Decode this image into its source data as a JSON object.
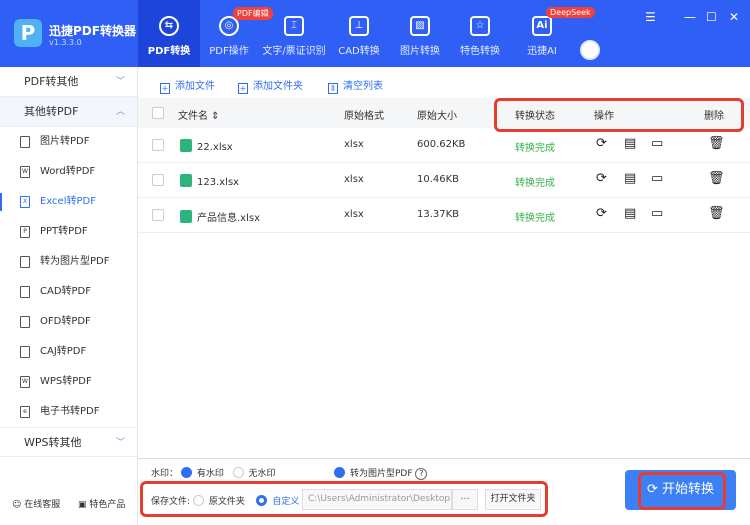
{
  "app": {
    "name": "迅捷PDF转换器",
    "version": "v1.3.3.0",
    "logo": "P"
  },
  "tabs": [
    {
      "label": "PDF转换",
      "icon": "⇆"
    },
    {
      "label": "PDF操作",
      "icon": "◎",
      "badge": "PDF编辑"
    },
    {
      "label": "文字/票证识别",
      "icon": "⌶"
    },
    {
      "label": "CAD转换",
      "icon": "⊥"
    },
    {
      "label": "图片转换",
      "icon": "▨"
    },
    {
      "label": "特色转换",
      "icon": "☆"
    },
    {
      "label": "迅捷AI",
      "icon": "Ai",
      "badge": "DeepSeek"
    }
  ],
  "window": {
    "menu": "☰",
    "min": "—",
    "max": "☐",
    "close": "✕"
  },
  "sidebar": {
    "groups": [
      "PDF转其他",
      "其他转PDF",
      "WPS转其他"
    ],
    "items": [
      "图片转PDF",
      "Word转PDF",
      "Excel转PDF",
      "PPT转PDF",
      "转为图片型PDF",
      "CAD转PDF",
      "OFD转PDF",
      "CAJ转PDF",
      "WPS转PDF",
      "电子书转PDF"
    ],
    "service": "在线客服",
    "featured": "特色产品"
  },
  "toolbar": {
    "add_file": "添加文件",
    "add_folder": "添加文件夹",
    "clear": "清空列表"
  },
  "table": {
    "headers": {
      "name": "文件名 ⇕",
      "format": "原始格式",
      "size": "原始大小",
      "status": "转换状态",
      "ops": "操作",
      "delete": "删除"
    },
    "rows": [
      {
        "name": "22.xlsx",
        "format": "xlsx",
        "size": "600.62KB",
        "status": "转换完成"
      },
      {
        "name": "123.xlsx",
        "format": "xlsx",
        "size": "10.46KB",
        "status": "转换完成"
      },
      {
        "name": "产品信息.xlsx",
        "format": "xlsx",
        "size": "13.37KB",
        "status": "转换完成"
      }
    ]
  },
  "bottom": {
    "watermark_label": "水印：",
    "with_wm": "有水印",
    "no_wm": "无水印",
    "to_image_pdf": "转为图片型PDF",
    "help": "?",
    "save_label": "保存文件:",
    "orig_folder": "原文件夹",
    "custom": "自定义",
    "path": "C:\\Users\\Administrator\\Desktop",
    "browse": "···",
    "open_folder": "打开文件夹",
    "start": "开始转换"
  },
  "colors": {
    "header": "#2f5ff5",
    "accent": "#2f6ef0",
    "highlight": "#e63d2e",
    "success": "#37b24d"
  }
}
